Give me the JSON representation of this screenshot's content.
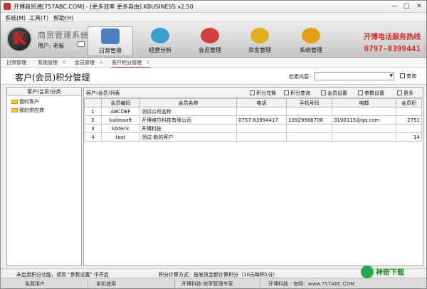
{
  "window": {
    "title": "开博商贸通[757ABC.COM] - [更多效率 更多自由]   KBUSINESS v2.50",
    "minimize": "—",
    "maximize": "□",
    "close": "✕"
  },
  "menu": [
    "系统(M)",
    "工具(T)",
    "帮助(H)"
  ],
  "banner": {
    "logo_k": "K",
    "system_name": "商贸管理系统",
    "user_label": "用户: 老板",
    "nav": [
      {
        "label": "日常管理",
        "icon": "calendar-icon",
        "color": "#4a7fc0"
      },
      {
        "label": "经营分析",
        "icon": "pie-chart-icon",
        "color": "#3aa0d0"
      },
      {
        "label": "会员管理",
        "icon": "members-icon",
        "color": "#d04040"
      },
      {
        "label": "资金管理",
        "icon": "coins-icon",
        "color": "#e0b020"
      },
      {
        "label": "系统管理",
        "icon": "gear-icon",
        "color": "#e0a010"
      }
    ],
    "phone_line1": "开博电话服务热线",
    "phone_line2": "0797-8399441"
  },
  "tabs": [
    {
      "label": "日常管理"
    },
    {
      "label": "系统管理"
    },
    {
      "label": "会员管理"
    },
    {
      "label": "客户积分管理"
    }
  ],
  "page": {
    "title": "客户(会员)积分管理",
    "search_label": "检索内容:",
    "search_value": "",
    "query_button": "查询"
  },
  "left_panel": {
    "header": "客户(会员)分类",
    "items": [
      "我的客户",
      "我的供应商"
    ]
  },
  "right_panel": {
    "header": "客户(会员)列表",
    "toolbar": [
      "积分兑换",
      "积分查询",
      "会员设置",
      "参数设置",
      "更多"
    ],
    "columns": [
      "",
      "会员编码",
      "会员名称",
      "电话",
      "手机号码",
      "电邮",
      "会员积"
    ],
    "rows": [
      {
        "no": "1",
        "code": "ABCDEF",
        "name": "测试公司名称",
        "phone": "",
        "mobile": "",
        "email": "",
        "points": ""
      },
      {
        "no": "2",
        "code": "kaibosoft",
        "name": "开博维尔科技有限公司",
        "phone": "0757-83994417",
        "mobile": "13929988706",
        "email": "3190115@qq.com",
        "points": "2751"
      },
      {
        "no": "3",
        "code": "kbteck",
        "name": "开博科技",
        "phone": "",
        "mobile": "",
        "email": "",
        "points": ""
      },
      {
        "no": "4",
        "code": "test",
        "name": "测试-新的客户",
        "phone": "",
        "mobile": "",
        "email": "",
        "points": "14"
      }
    ]
  },
  "status": {
    "left": "未启用积分功能，请到 \"参数设置\" 中开启",
    "right": "积分计算方式：按发货金额计算积分（10元每积1分）"
  },
  "footer": [
    "免费用户",
    "单机使用",
    "开博科技-效率管理专家",
    "开博科技 - 官网：www.757ABC.COM"
  ],
  "watermark": "神奇下载"
}
